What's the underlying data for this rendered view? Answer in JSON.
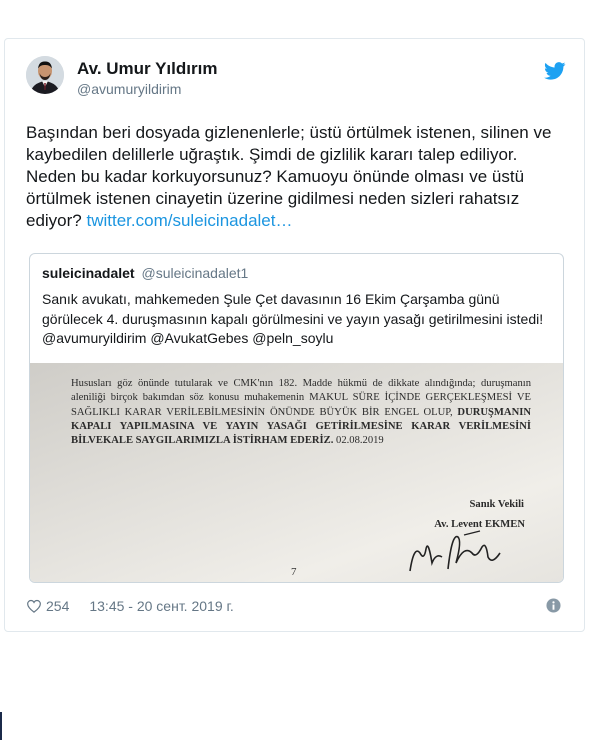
{
  "author": {
    "name": "Av. Umur Yıldırım",
    "handle": "@avumuryildirim"
  },
  "icons": {
    "brand": "twitter-bird-icon",
    "like": "heart-icon",
    "info": "info-icon"
  },
  "tweet": {
    "text": "Başından beri dosyada gizlenenlerle; üstü örtülmek istenen, silinen ve kaybedilen delillerle uğraştık. Şimdi de gizlilik kararı talep ediliyor. Neden bu kadar korkuyorsunuz? Kamuoyu önünde olması ve üstü örtülmek istenen cinayetin üzerine gidilmesi neden sizleri rahatsız ediyor?",
    "link": "twitter.com/suleicinadalet…"
  },
  "quoted_tweet": {
    "name": "suleicinadalet",
    "handle": "@suleicinadalet1",
    "text": "Sanık avukatı, mahkemeden Şule Çet davasının 16 Ekim Çarşamba günü görülecek 4. duruşmasının kapalı görülmesini ve yayın yasağı getirilmesini istedi! @avumuryildirim @AvukatGebes @peln_soylu",
    "image": {
      "body_regular": "Hususları göz önünde tutularak ve CMK'nın 182. Madde hükmü de dikkate alındığında; duruşmanın aleniliği birçok bakımdan söz konusu muhakemenin MAKUL SÜRE İÇİNDE GERÇEKLEŞMESİ VE SAĞLIKLI KARAR VERİLEBİLMESİNİN ÖNÜNDE BÜYÜK BİR ENGEL OLUP,",
      "body_bold": "DURUŞMANIN KAPALI YAPILMASINA VE YAYIN YASAĞI GETİRİLMESİNE KARAR VERİLMESİNİ BİLVEKALE SAYGILARIMIZLA İSTİRHAM EDERİZ.",
      "date": "02.08.2019",
      "signer_title": "Sanık Vekili",
      "signer_name": "Av. Levent EKMEN",
      "page_number": "7"
    }
  },
  "footer": {
    "likes": "254",
    "timestamp": "13:45 - 20 сент. 2019 г."
  },
  "colors": {
    "text": "#14171a",
    "secondary": "#657786",
    "link": "#1b95e0",
    "twitter_blue": "#1da1f2",
    "border": "#e1e8ed"
  }
}
